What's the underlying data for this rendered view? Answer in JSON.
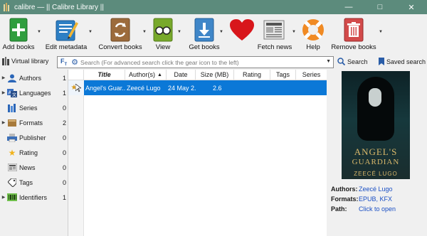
{
  "window": {
    "title": "calibre — || Calibre Library ||",
    "controls": [
      "—",
      "□",
      "✕"
    ]
  },
  "toolbar": {
    "add_books": "Add books",
    "edit_metadata": "Edit metadata",
    "convert_books": "Convert books",
    "view": "View",
    "get_books": "Get books",
    "fetch_news": "Fetch news",
    "help": "Help",
    "remove_books": "Remove books"
  },
  "search": {
    "virtual_library": "Virtual library",
    "placeholder": "Search (For advanced search click the gear icon to the left)",
    "search_label": "Search",
    "saved_search_label": "Saved search"
  },
  "sidebar": {
    "items": [
      {
        "label": "Authors",
        "count": "1",
        "expandable": true
      },
      {
        "label": "Languages",
        "count": "1",
        "expandable": true
      },
      {
        "label": "Series",
        "count": "0",
        "expandable": false
      },
      {
        "label": "Formats",
        "count": "2",
        "expandable": true
      },
      {
        "label": "Publisher",
        "count": "0",
        "expandable": false
      },
      {
        "label": "Rating",
        "count": "0",
        "expandable": false
      },
      {
        "label": "News",
        "count": "0",
        "expandable": false
      },
      {
        "label": "Tags",
        "count": "0",
        "expandable": false
      },
      {
        "label": "Identifiers",
        "count": "1",
        "expandable": true
      }
    ]
  },
  "booklist": {
    "columns": [
      "Title",
      "Author(s)",
      "Date",
      "Size (MB)",
      "Rating",
      "Tags",
      "Series"
    ],
    "sort_indicator": "▲",
    "rows": [
      {
        "title": "Angel's Guar...",
        "authors": "Zeecé Lugo",
        "date": "24 May 2...",
        "size": "2.6",
        "rating": "",
        "tags": "",
        "series": ""
      }
    ]
  },
  "details": {
    "cover_title_line1": "ANGEL'S",
    "cover_title_line2": "GUARDIAN",
    "cover_author": "ZEECÉ LUGO",
    "authors_key": "Authors:",
    "authors_value": "Zeecé Lugo",
    "formats_key": "Formats:",
    "formats_value": "EPUB, KFX",
    "path_key": "Path:",
    "path_value": "Click to open"
  },
  "colors": {
    "titlebar": "#5c8b7c",
    "selection": "#0b78d7",
    "link": "#1a4fc4"
  }
}
